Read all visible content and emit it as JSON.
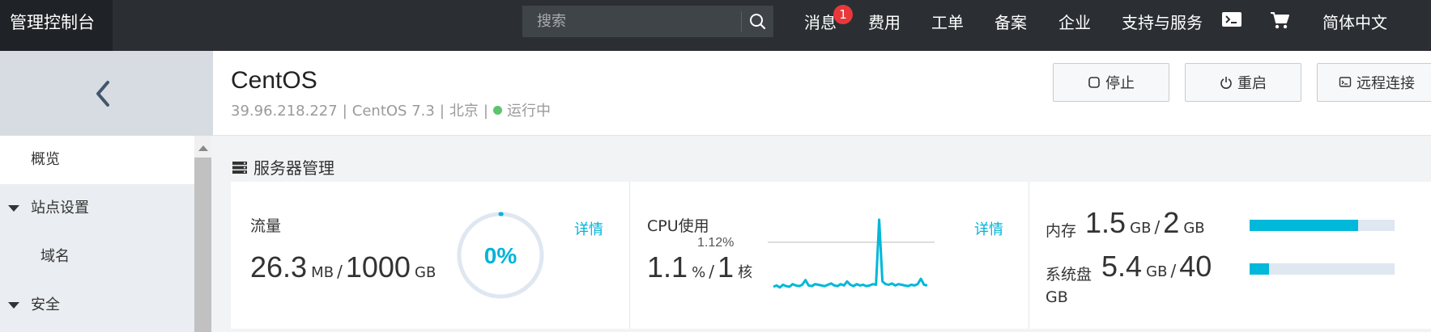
{
  "topbar": {
    "brand": "管理控制台",
    "search_placeholder": "搜索",
    "nav": {
      "messages": "消息",
      "messages_badge": "1",
      "billing": "费用",
      "tickets": "工单",
      "icp": "备案",
      "enterprise": "企业",
      "support": "支持与服务",
      "language": "简体中文"
    },
    "icons": [
      "search-icon",
      "terminal-icon",
      "cart-icon"
    ]
  },
  "sidebar": {
    "items": [
      {
        "label": "概览",
        "active": true
      },
      {
        "label": "站点设置",
        "expanded": true
      },
      {
        "label": "域名"
      },
      {
        "label": "安全",
        "expanded": true
      }
    ]
  },
  "instance": {
    "name": "CentOS",
    "ip": "39.96.218.227",
    "os": "CentOS 7.3",
    "region": "北京",
    "status": "运行中",
    "status_color": "#5cc36e",
    "buttons": {
      "stop": "停止",
      "restart": "重启",
      "remote": "远程连接"
    }
  },
  "section": {
    "title": "服务器管理"
  },
  "traffic": {
    "label": "流量",
    "used": "26.3",
    "used_unit": "MB",
    "total": "1000",
    "total_unit": "GB",
    "percent_text": "0%",
    "percent": 0,
    "detail": "详情"
  },
  "cpu": {
    "label": "CPU使用",
    "value": "1.1",
    "value_unit": "%",
    "cores": "1",
    "cores_unit": "核",
    "peak": "1.12%",
    "detail": "详情",
    "series": [
      0.12,
      0.14,
      0.11,
      0.15,
      0.13,
      0.12,
      0.16,
      0.14,
      0.13,
      0.15,
      0.22,
      0.14,
      0.13,
      0.16,
      0.15,
      0.14,
      0.13,
      0.15,
      0.17,
      0.14,
      0.13,
      0.16,
      0.14,
      0.2,
      0.15,
      0.13,
      0.16,
      0.14,
      0.15,
      0.13,
      0.14,
      0.16,
      0.15,
      1.12,
      0.2,
      0.16,
      0.15,
      0.17,
      0.14,
      0.16,
      0.15,
      0.14,
      0.13,
      0.15,
      0.14,
      0.16,
      0.24,
      0.15,
      0.14
    ]
  },
  "memory": {
    "label": "内存",
    "used": "1.5",
    "used_unit": "GB",
    "total": "2",
    "total_unit": "GB",
    "fraction": 0.75,
    "bar_color": "#00b8d9"
  },
  "disk": {
    "label": "系统盘",
    "used": "5.4",
    "used_unit": "GB",
    "total": "40",
    "total_unit": "GB",
    "fraction": 0.135,
    "bar_color": "#00b8d9"
  }
}
